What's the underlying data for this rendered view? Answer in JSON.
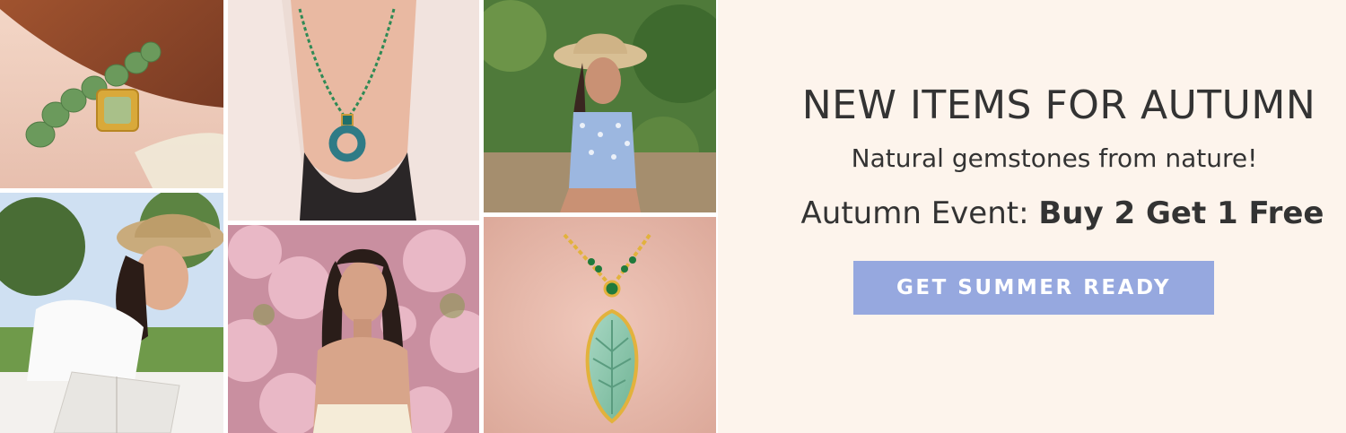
{
  "promo": {
    "headline": "NEW ITEMS FOR AUTUMN",
    "subline": "Natural gemstones from nature!",
    "event_label": "Autumn Event: ",
    "event_offer": "Buy 2 Get 1 Free",
    "cta_label": "GET SUMMER READY"
  },
  "colors": {
    "background": "#fdf4ec",
    "text": "#333333",
    "cta_background": "#96a8df",
    "cta_text": "#ffffff"
  },
  "photos": [
    {
      "name": "jade-bracelet-photo"
    },
    {
      "name": "jade-ring-pendant-necklace-photo"
    },
    {
      "name": "woman-straw-hat-garden-photo"
    },
    {
      "name": "woman-reading-on-grass-photo"
    },
    {
      "name": "woman-cherry-blossoms-photo"
    },
    {
      "name": "jade-leaf-pendant-photo"
    }
  ]
}
